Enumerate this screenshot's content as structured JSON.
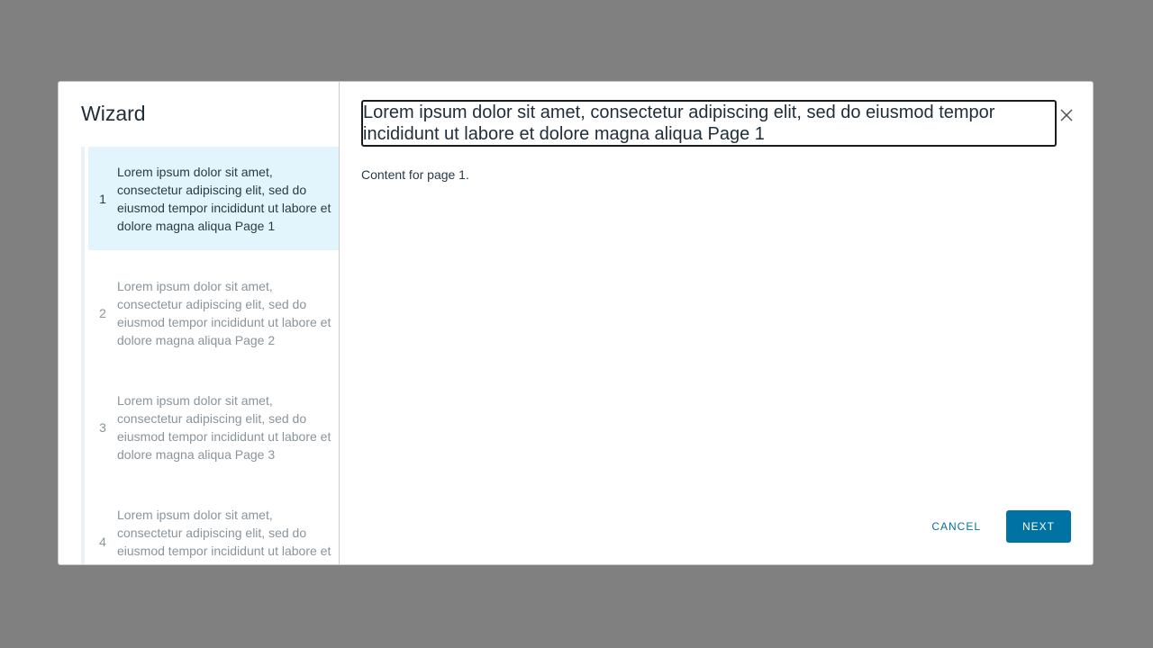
{
  "wizard": {
    "title": "Wizard",
    "steps": [
      {
        "number": "1",
        "label": "Lorem ipsum dolor sit amet, consectetur adipiscing elit, sed do eiusmod tempor incididunt ut labore et dolore magna aliqua Page 1",
        "state": "active"
      },
      {
        "number": "2",
        "label": "Lorem ipsum dolor sit amet, consectetur adipiscing elit, sed do eiusmod tempor incididunt ut labore et dolore magna aliqua Page 2",
        "state": "inactive"
      },
      {
        "number": "3",
        "label": "Lorem ipsum dolor sit amet, consectetur adipiscing elit, sed do eiusmod tempor incididunt ut labore et dolore magna aliqua Page 3",
        "state": "inactive"
      },
      {
        "number": "4",
        "label": "Lorem ipsum dolor sit amet, consectetur adipiscing elit, sed do eiusmod tempor incididunt ut labore et dolore magna aliqua Page",
        "state": "inactive"
      }
    ]
  },
  "page": {
    "title": "Lorem ipsum dolor sit amet, consectetur adipiscing elit, sed do eiusmod tempor incididunt ut labore et dolore magna aliqua Page 1",
    "content": "Content for page 1."
  },
  "footer": {
    "cancel_label": "CANCEL",
    "next_label": "NEXT"
  },
  "icons": {
    "close": "close-icon"
  },
  "colors": {
    "accent": "#0072a3",
    "active_step_bg": "#e3f5fc",
    "backdrop": "#808080"
  }
}
